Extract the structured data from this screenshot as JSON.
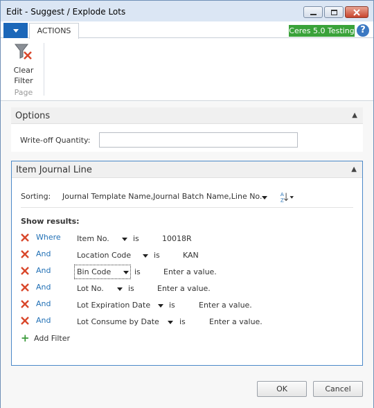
{
  "window": {
    "title": "Edit - Suggest / Explode Lots"
  },
  "ribbon": {
    "tab_label": "ACTIONS",
    "environment_badge": "Ceres 5.0 Testing",
    "help_label": "?",
    "clear_filter_line1": "Clear",
    "clear_filter_line2": "Filter",
    "group_label": "Page"
  },
  "options": {
    "title": "Options",
    "write_off_label": "Write-off Quantity:",
    "write_off_value": ""
  },
  "item_journal_line": {
    "title": "Item Journal Line",
    "sorting_label": "Sorting:",
    "sorting_value": "Journal Template Name,Journal Batch Name,Line No.",
    "show_results_label": "Show results:",
    "filters": [
      {
        "op": "Where",
        "field": "Item No.",
        "is": "is",
        "value": "10018R"
      },
      {
        "op": "And",
        "field": "Location Code",
        "is": "is",
        "value": "KAN"
      },
      {
        "op": "And",
        "field": "Bin Code",
        "is": "is",
        "value": "Enter a value."
      },
      {
        "op": "And",
        "field": "Lot No.",
        "is": "is",
        "value": "Enter a value."
      },
      {
        "op": "And",
        "field": "Lot Expiration Date",
        "is": "is",
        "value": "Enter a value."
      },
      {
        "op": "And",
        "field": "Lot Consume by Date",
        "is": "is",
        "value": "Enter a value."
      }
    ],
    "add_filter_label": "Add Filter"
  },
  "buttons": {
    "ok": "OK",
    "cancel": "Cancel"
  },
  "colors": {
    "accent_blue": "#1b67b9",
    "badge_green": "#3aa23a",
    "remove_red": "#d9472b",
    "link_blue": "#1f6fb5"
  }
}
